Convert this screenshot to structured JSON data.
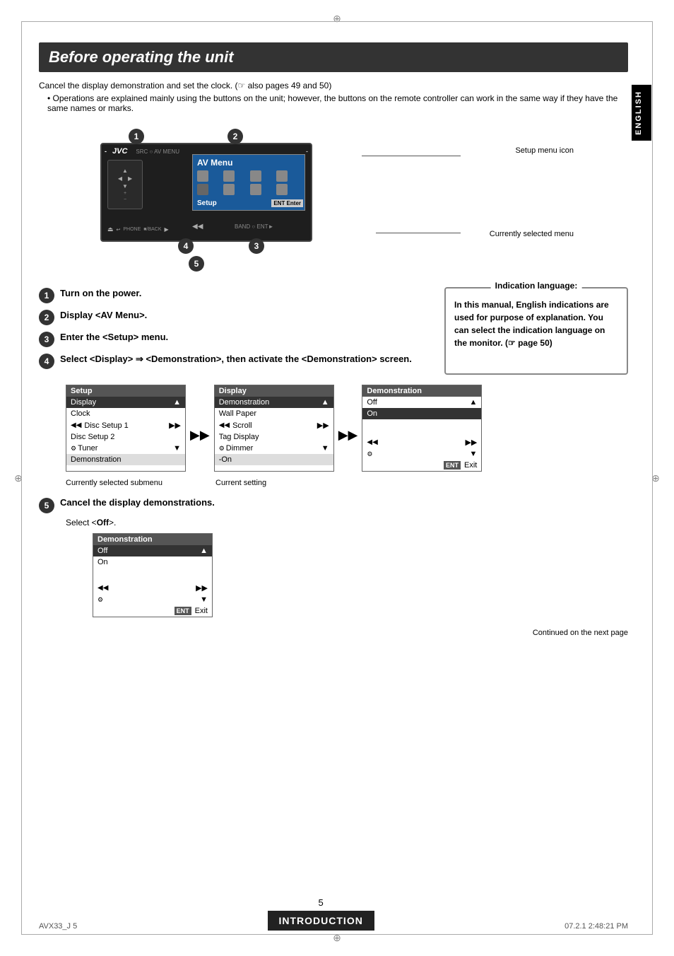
{
  "page": {
    "title": "Before operating the unit",
    "side_tab": "ENGLISH",
    "intro_line1": "Cancel the display demonstration and set the clock. (☞ also pages 49 and 50)",
    "intro_bullet": "Operations are explained mainly using the buttons on the unit; however, the buttons on the remote controller can work in the same way if they have the same names or marks.",
    "setup_menu_icon_label": "Setup menu icon",
    "currently_selected_label": "Currently selected menu",
    "steps": [
      {
        "num": "1",
        "text": "Turn on the power."
      },
      {
        "num": "2",
        "text": "Display <AV Menu>."
      },
      {
        "num": "3",
        "text": "Enter the <Setup> menu."
      },
      {
        "num": "4",
        "text": "Select <Display> ⇒ <Demonstration>, then activate the <Demonstration> screen."
      }
    ],
    "indication_language": {
      "title": "Indication language:",
      "body": "In this manual, English indications are used for purpose of explanation. You can select the indication language on the monitor. (☞ page 50)"
    },
    "setup_panel": {
      "header": "Setup",
      "items": [
        "Display",
        "Clock",
        "Disc Setup 1",
        "Disc Setup 2",
        "Tuner",
        "Demonstration"
      ],
      "selected": "Display"
    },
    "display_panel": {
      "header": "Display",
      "items": [
        "Demonstration",
        "Wall Paper",
        "Scroll",
        "Tag Display",
        "Dimmer"
      ],
      "selected": "Demonstration"
    },
    "demonstration_panel": {
      "header": "Demonstration",
      "items": [
        "Off",
        "On"
      ],
      "selected": "On"
    },
    "panel_labels": {
      "left": "Currently selected submenu",
      "right": "Current setting"
    },
    "step5": {
      "num": "5",
      "heading": "Cancel the display demonstrations.",
      "subtext": "Select <Off>."
    },
    "demo_panel2": {
      "header": "Demonstration",
      "items": [
        "Off",
        "On"
      ]
    },
    "footer": {
      "left": "AVX33_J  5",
      "center_page": "5",
      "right": "07.2.1  2:48:21 PM",
      "continued": "Continued on the next page",
      "section": "INTRODUCTION"
    }
  }
}
